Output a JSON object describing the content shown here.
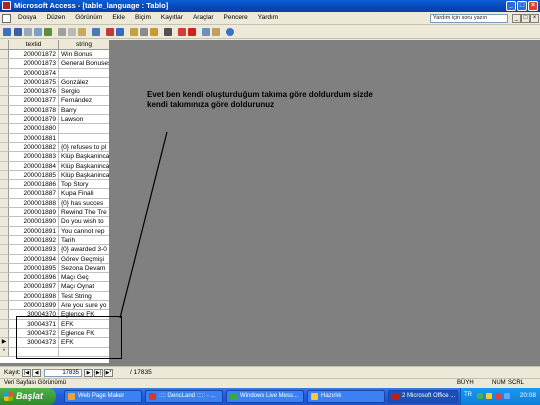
{
  "window": {
    "title": "Microsoft Access - [table_language : Tablo]"
  },
  "menu": {
    "items": [
      "Dosya",
      "Düzen",
      "Görünüm",
      "Ekle",
      "Biçim",
      "Kayıtlar",
      "Araçlar",
      "Pencere",
      "Yardım"
    ],
    "help_placeholder": "Yardım için soru yazın"
  },
  "table": {
    "columns": [
      "textid",
      "string"
    ],
    "rows": [
      {
        "textid": "200001872",
        "string": "Win Bonus"
      },
      {
        "textid": "200001873",
        "string": "General Bonuses"
      },
      {
        "textid": "200001874",
        "string": ""
      },
      {
        "textid": "200001875",
        "string": "González"
      },
      {
        "textid": "200001876",
        "string": "Sergio"
      },
      {
        "textid": "200001877",
        "string": "Fernández"
      },
      {
        "textid": "200001878",
        "string": "Barry"
      },
      {
        "textid": "200001879",
        "string": "Lawson"
      },
      {
        "textid": "200001880",
        "string": ""
      },
      {
        "textid": "200001881",
        "string": ""
      },
      {
        "textid": "200001882",
        "string": "{0} refuses to pl"
      },
      {
        "textid": "200001883",
        "string": "Klüp Başkaninca"
      },
      {
        "textid": "200001884",
        "string": "Klüp Başkaninca"
      },
      {
        "textid": "200001885",
        "string": "Klüp Başkaninca"
      },
      {
        "textid": "200001886",
        "string": "Top Story"
      },
      {
        "textid": "200001887",
        "string": "Kupa Finali"
      },
      {
        "textid": "200001888",
        "string": "{0} has succes"
      },
      {
        "textid": "200001889",
        "string": "Rewind The Tre"
      },
      {
        "textid": "200001890",
        "string": "Do you wish to"
      },
      {
        "textid": "200001891",
        "string": "You cannot rep"
      },
      {
        "textid": "200001892",
        "string": "Tarih"
      },
      {
        "textid": "200001893",
        "string": "{0} awarded 3-0"
      },
      {
        "textid": "200001894",
        "string": "Görev Geçmişi"
      },
      {
        "textid": "200001895",
        "string": "Sezona Devam"
      },
      {
        "textid": "200001896",
        "string": "Maçı Geç"
      },
      {
        "textid": "200001897",
        "string": "Maçı Oynat"
      },
      {
        "textid": "200001898",
        "string": "Test String"
      },
      {
        "textid": "200001899",
        "string": "Are you sure yo"
      },
      {
        "textid": "30004370",
        "string": "Eglence FK"
      },
      {
        "textid": "30004371",
        "string": "EFK"
      },
      {
        "textid": "30004372",
        "string": "Eglence FK"
      },
      {
        "textid": "30004373",
        "string": "EFK"
      }
    ],
    "current_row_marker": "▶",
    "new_row_marker": "*"
  },
  "annotation": {
    "text": "Evet ben kendi oluşturduğum takıma göre doldurdum sizde kendi takımınıza göre doldurunuz"
  },
  "navigator": {
    "label": "Kayıt:",
    "current": "17835",
    "total_label": "/ 17835"
  },
  "status": {
    "left": "Veri Sayfası Görünümü",
    "indicators": [
      "BÜYH",
      "NUM",
      "SCRL"
    ]
  },
  "taskbar": {
    "start_label": "Başlat",
    "tasks": [
      {
        "label": "Web Page Maker",
        "icon_color": "#e8a33a"
      },
      {
        "label": ":::: GencLand ::::: - ...",
        "icon_color": "#d33a2a"
      },
      {
        "label": "Windows Live Mess...",
        "icon_color": "#3aa84a"
      },
      {
        "label": "Hazırlık",
        "icon_color": "#f2c94c"
      },
      {
        "label": "2 Microsoft Office ...",
        "icon_color": "#b22222"
      }
    ],
    "language": "TR",
    "clock": "20:08"
  }
}
